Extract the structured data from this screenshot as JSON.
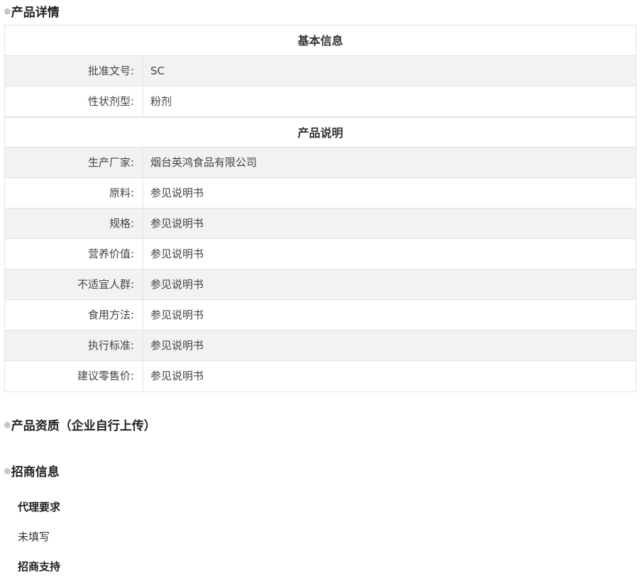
{
  "sections": {
    "details_title": "产品详情",
    "qualification_title": "产品资质（企业自行上传）",
    "investment_title": "招商信息"
  },
  "marker_glyph": "◎",
  "basic_info": {
    "title": "基本信息",
    "rows": [
      {
        "label": "批准文号:",
        "value": "SC"
      },
      {
        "label": "性状剂型:",
        "value": "粉剂"
      }
    ]
  },
  "product_desc": {
    "title": "产品说明",
    "rows": [
      {
        "label": "生产厂家:",
        "value": "烟台英鸿食品有限公司"
      },
      {
        "label": "原料:",
        "value": "参见说明书"
      },
      {
        "label": "规格:",
        "value": "参见说明书"
      },
      {
        "label": "营养价值:",
        "value": "参见说明书"
      },
      {
        "label": "不适宜人群:",
        "value": "参见说明书"
      },
      {
        "label": "食用方法:",
        "value": "参见说明书"
      },
      {
        "label": "执行标准:",
        "value": "参见说明书"
      },
      {
        "label": "建议零售价:",
        "value": "参见说明书"
      }
    ]
  },
  "investment": {
    "agent_req_label": "代理要求",
    "agent_req_value": "未填写",
    "support_label": "招商支持"
  }
}
